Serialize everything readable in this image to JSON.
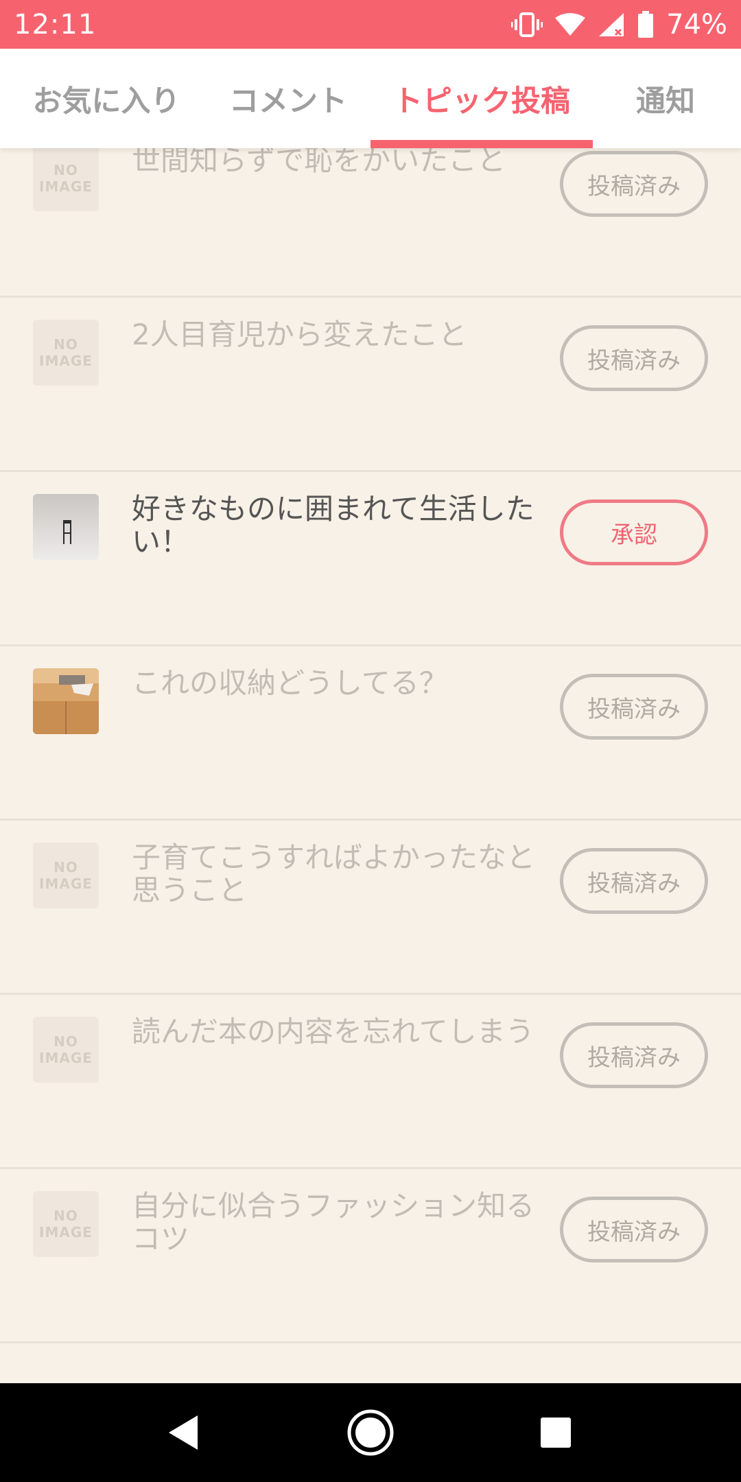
{
  "status_bar": {
    "time": "12:11",
    "battery": "74%",
    "icons": [
      "vibrate-icon",
      "wifi-icon",
      "signal-icon",
      "battery-icon"
    ]
  },
  "tabs": [
    {
      "label": "お気に入り",
      "active": false
    },
    {
      "label": "コメント",
      "active": false
    },
    {
      "label": "トピック投稿",
      "active": true
    },
    {
      "label": "通知",
      "active": false
    }
  ],
  "no_image": {
    "line1": "NO",
    "line2": "IMAGE"
  },
  "posts": [
    {
      "title": "世間知らずで恥をかいたこと",
      "thumbnail": "no-image",
      "status": "投稿済み",
      "highlight": false
    },
    {
      "title": "2人目育児から変えたこと",
      "thumbnail": "no-image",
      "status": "投稿済み",
      "highlight": false
    },
    {
      "title": "好きなものに囲まれて生活したい！",
      "thumbnail": "chair-photo",
      "status": "承認",
      "highlight": true
    },
    {
      "title": "これの収納どうしてる？",
      "thumbnail": "storage-photo",
      "status": "投稿済み",
      "highlight": false
    },
    {
      "title": "子育てこうすればよかったなと思うこと",
      "thumbnail": "no-image",
      "status": "投稿済み",
      "highlight": false
    },
    {
      "title": "読んだ本の内容を忘れてしまう",
      "thumbnail": "no-image",
      "status": "投稿済み",
      "highlight": false
    },
    {
      "title": "自分に似合うファッション知るコツ",
      "thumbnail": "no-image",
      "status": "投稿済み",
      "highlight": false
    }
  ],
  "colors": {
    "accent": "#f6636f",
    "background": "#f8f1e7",
    "muted_text": "#c2bcb5"
  }
}
